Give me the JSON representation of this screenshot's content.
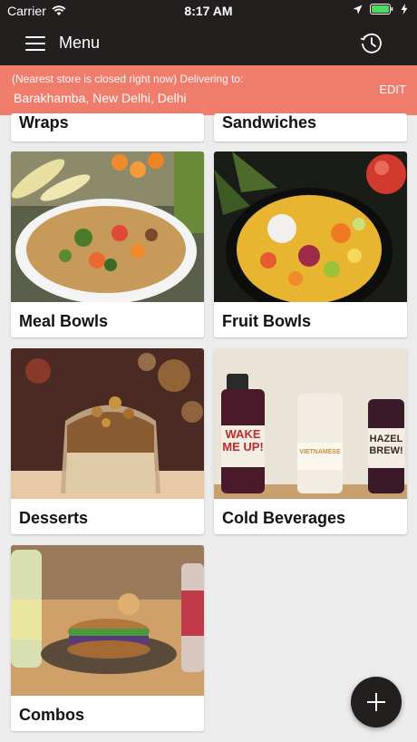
{
  "status_bar": {
    "carrier": "Carrier",
    "time": "8:17 AM"
  },
  "nav": {
    "title": "Menu",
    "menu_icon": "hamburger-icon",
    "history_icon": "history-clock-icon"
  },
  "banner": {
    "notice": "(Nearest store is closed right now) Delivering to:",
    "address": "Barakhamba, New Delhi, Delhi",
    "edit_label": "EDIT",
    "color": "#f07c6c"
  },
  "categories": [
    {
      "label": "Wraps"
    },
    {
      "label": "Sandwiches"
    },
    {
      "label": "Meal Bowls"
    },
    {
      "label": "Fruit Bowls"
    },
    {
      "label": "Desserts"
    },
    {
      "label": "Cold Beverages"
    },
    {
      "label": "Combos"
    }
  ],
  "beverage_labels": {
    "bottle1": "WAKE ME UP!",
    "bottle2": "VIETNAMESE",
    "bottle3": "HAZEL BREW!"
  },
  "fab_icon": "plus-icon",
  "theme": {
    "dark": "#231f1e",
    "accent": "#f07c6c",
    "background": "#ececec"
  }
}
